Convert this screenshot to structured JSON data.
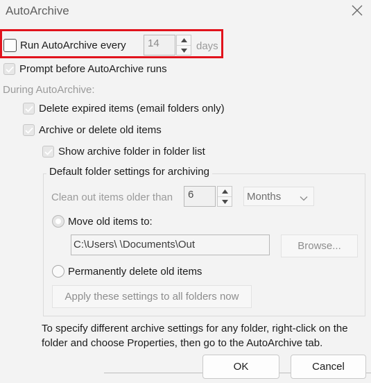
{
  "window": {
    "title": "AutoArchive"
  },
  "run_autoarchive": {
    "label": "Run AutoArchive every",
    "checked": false,
    "value": "14",
    "unit": "days"
  },
  "prompt_before": {
    "label": "Prompt before AutoArchive runs",
    "checked": true
  },
  "during_heading": "During AutoArchive:",
  "delete_expired": {
    "label": "Delete expired items (email folders only)",
    "checked": true
  },
  "archive_old": {
    "label": "Archive or delete old items",
    "checked": true
  },
  "show_archive_folder": {
    "label": "Show archive folder in folder list",
    "checked": true
  },
  "default_group": {
    "title": "Default folder settings for archiving",
    "clean_out_label": "Clean out items older than",
    "clean_out_value": "6",
    "period_selected": "Months",
    "move_label": "Move old items to:",
    "move_path": "C:\\Users\\                           \\Documents\\Out",
    "browse_label": "Browse...",
    "delete_label": "Permanently delete old items",
    "apply_label": "Apply these settings to all folders now"
  },
  "info_text": "To specify different archive settings for any folder, right-click on the folder and choose Properties, then go to the AutoArchive tab.",
  "buttons": {
    "ok": "OK",
    "cancel": "Cancel"
  },
  "colors": {
    "highlight": "#e1131c",
    "background": "#f3f3f3"
  }
}
